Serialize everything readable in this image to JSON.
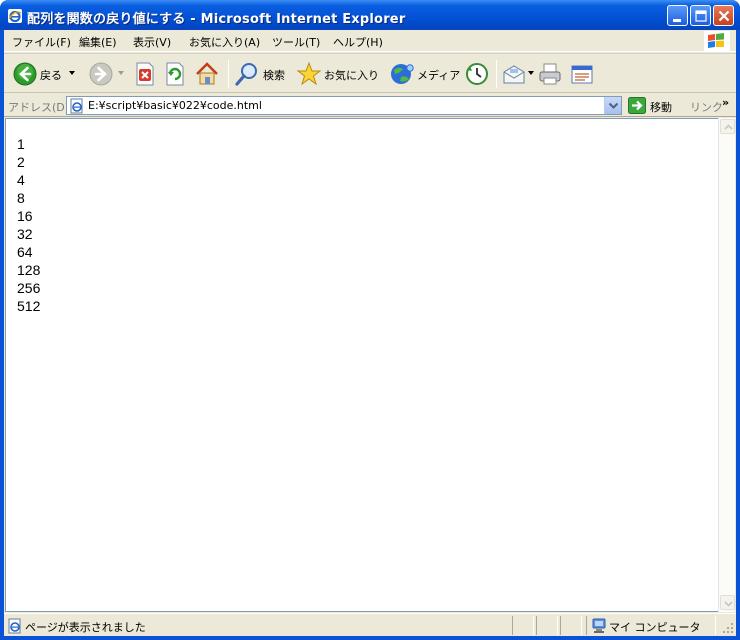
{
  "window": {
    "title": "配列を関数の戻り値にする - Microsoft Internet Explorer"
  },
  "menu": {
    "items": [
      "ファイル(F)",
      "編集(E)",
      "表示(V)",
      "お気に入り(A)",
      "ツール(T)",
      "ヘルプ(H)"
    ]
  },
  "toolbar": {
    "back_label": "戻る",
    "search_label": "検索",
    "favorites_label": "お気に入り",
    "media_label": "メディア"
  },
  "address": {
    "label": "アドレス(D)",
    "url": "E:¥script¥basic¥022¥code.html",
    "go_label": "移動",
    "links_label": "リンク",
    "links_more": "»"
  },
  "page": {
    "lines": [
      "1",
      "2",
      "4",
      "8",
      "16",
      "32",
      "64",
      "128",
      "256",
      "512"
    ]
  },
  "status": {
    "text": "ページが表示されました",
    "zone": "マイ コンピュータ"
  }
}
